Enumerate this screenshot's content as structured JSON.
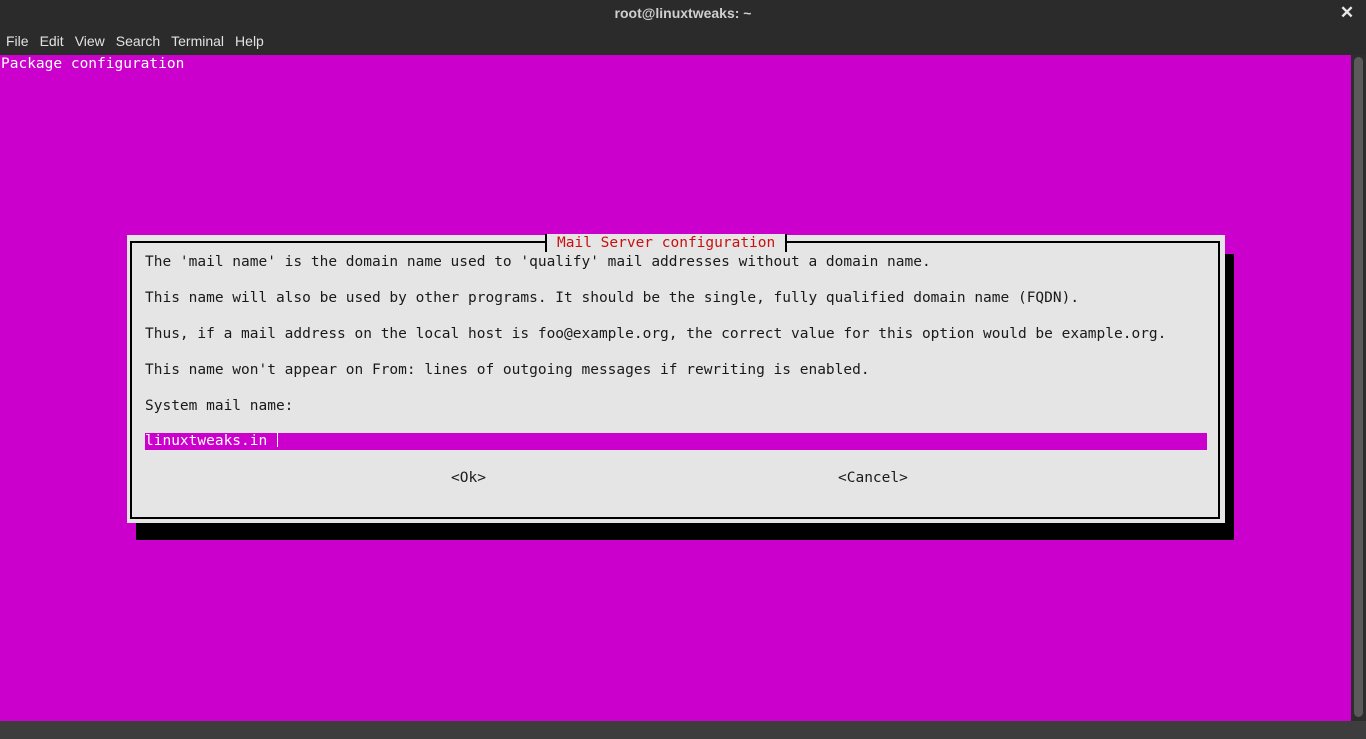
{
  "window": {
    "title": "root@linuxtweaks: ~",
    "close_glyph": "✕"
  },
  "menubar": {
    "items": [
      "File",
      "Edit",
      "View",
      "Search",
      "Terminal",
      "Help"
    ]
  },
  "terminal": {
    "header": "Package configuration",
    "background_color": "#cc00cc"
  },
  "dialog": {
    "title": "Mail Server configuration",
    "lines": [
      "The 'mail name' is the domain name used to 'qualify' mail addresses without a domain name.",
      "This name will also be used by other programs. It should be the single, fully qualified domain name (FQDN).",
      "Thus, if a mail address on the local host is foo@example.org, the correct value for this option would be example.org.",
      "This name won't appear on From: lines of outgoing messages if rewriting is enabled.",
      "System mail name:"
    ],
    "input_value": "linuxtweaks.in",
    "ok_label": "<Ok>",
    "cancel_label": "<Cancel>"
  }
}
